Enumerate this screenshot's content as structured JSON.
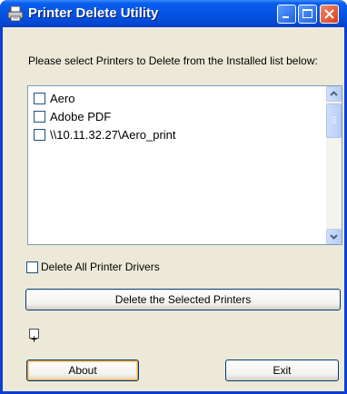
{
  "window": {
    "title": "Printer Delete Utility"
  },
  "instructions": "Please select Printers to Delete from the Installed list below:",
  "printers": [
    {
      "label": "Aero",
      "checked": false
    },
    {
      "label": "Adobe PDF",
      "checked": false
    },
    {
      "label": "\\\\10.11.32.27\\Aero_print",
      "checked": false
    }
  ],
  "options": {
    "delete_all_drivers_label": "Delete All Printer Drivers",
    "delete_all_drivers_checked": false
  },
  "buttons": {
    "delete_selected": "Delete the Selected Printers",
    "about": "About",
    "exit": "Exit"
  },
  "icons": {
    "app": "printer-icon",
    "expand": "plus-box-icon"
  }
}
